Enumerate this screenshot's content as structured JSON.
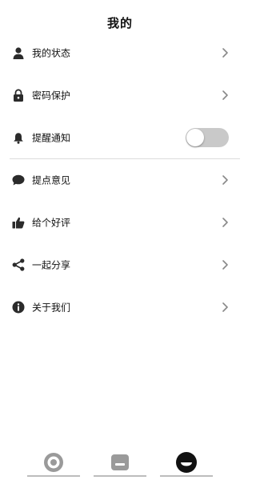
{
  "header": {
    "title": "我的"
  },
  "menu": [
    {
      "label": "我的状态",
      "icon": "person-icon"
    },
    {
      "label": "密码保护",
      "icon": "lock-icon"
    },
    {
      "label": "提醒通知",
      "icon": "bell-icon",
      "toggle_on": false
    },
    {
      "label": "提点意见",
      "icon": "speech-bubble-icon"
    },
    {
      "label": "给个好评",
      "icon": "thumbs-up-icon"
    },
    {
      "label": "一起分享",
      "icon": "share-icon"
    },
    {
      "label": "关于我们",
      "icon": "info-icon"
    }
  ],
  "tabbar": {
    "tabs": [
      {
        "icon": "target-icon",
        "active": false
      },
      {
        "icon": "card-icon",
        "active": false
      },
      {
        "icon": "smile-icon",
        "active": true
      }
    ]
  },
  "colors": {
    "text": "#111111",
    "icon": "#2b2b2b",
    "chevron": "#888888",
    "toggle_track": "#c9c9c9",
    "inactive_tab_icon": "#9a9a9a",
    "active_tab_icon": "#111111"
  }
}
